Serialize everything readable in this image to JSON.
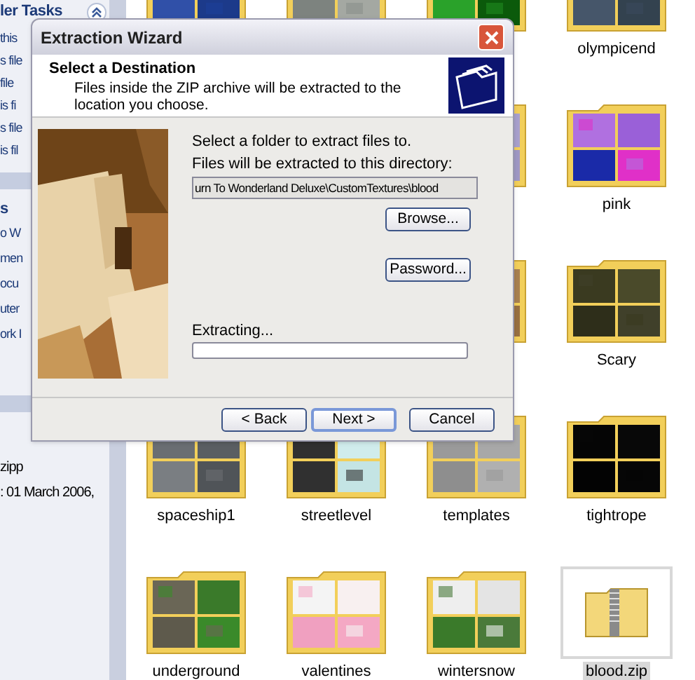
{
  "sidebar": {
    "panels": [
      {
        "title": "ler Tasks",
        "expanded": true,
        "items": [
          "this",
          "s file",
          "file",
          "is fi",
          "s file",
          "is fil"
        ]
      },
      {
        "title": "s",
        "items": [
          "o W",
          "men",
          "ocu",
          "uter",
          "ork I"
        ]
      },
      {
        "items": [
          "zipp",
          ": 01 March 2006,"
        ]
      }
    ]
  },
  "icon_rows": [
    {
      "items": [
        {
          "kind": "folder"
        },
        {
          "kind": "folder"
        },
        {
          "kind": "folder"
        },
        {
          "kind": "folder",
          "label": "olympicend",
          "selected": false
        }
      ]
    },
    {
      "items": [
        {
          "kind": "folder"
        },
        {
          "kind": "folder",
          "label": "pink",
          "selected": false
        }
      ]
    },
    {
      "items": [
        {
          "kind": "folder"
        },
        {
          "kind": "folder",
          "label": "Scary",
          "selected": false
        }
      ]
    },
    {
      "items": [
        {
          "kind": "folder",
          "label": "spaceship1",
          "selected": false
        },
        {
          "kind": "folder",
          "label": "streetlevel",
          "selected": false
        },
        {
          "kind": "folder",
          "label": "templates",
          "selected": false
        },
        {
          "kind": "folder",
          "label": "tightrope",
          "selected": false
        }
      ]
    },
    {
      "items": [
        {
          "kind": "folder",
          "label": "underground",
          "selected": false
        },
        {
          "kind": "folder",
          "label": "valentines",
          "selected": false
        },
        {
          "kind": "folder",
          "label": "wintersnow",
          "selected": false
        },
        {
          "kind": "zip",
          "label": "blood.zip",
          "selected": true
        }
      ]
    }
  ],
  "dialog": {
    "title": "Extraction Wizard",
    "heading": "Select a Destination",
    "subtitle": "Files inside the ZIP archive will be extracted to the location you choose.",
    "prompt": "Select a folder to extract files to.",
    "field_label": "Files will be extracted to this directory:",
    "directory": "urn To Wonderland Deluxe\\CustomTextures\\blood",
    "browse_button": "Browse...",
    "password_button": "Password...",
    "progress_label": "Extracting...",
    "progress": {
      "level": 0
    },
    "buttons": [
      {
        "label": "< Back",
        "default": false
      },
      {
        "label": "Next >",
        "default": true
      },
      {
        "label": "Cancel",
        "default": false
      }
    ]
  }
}
